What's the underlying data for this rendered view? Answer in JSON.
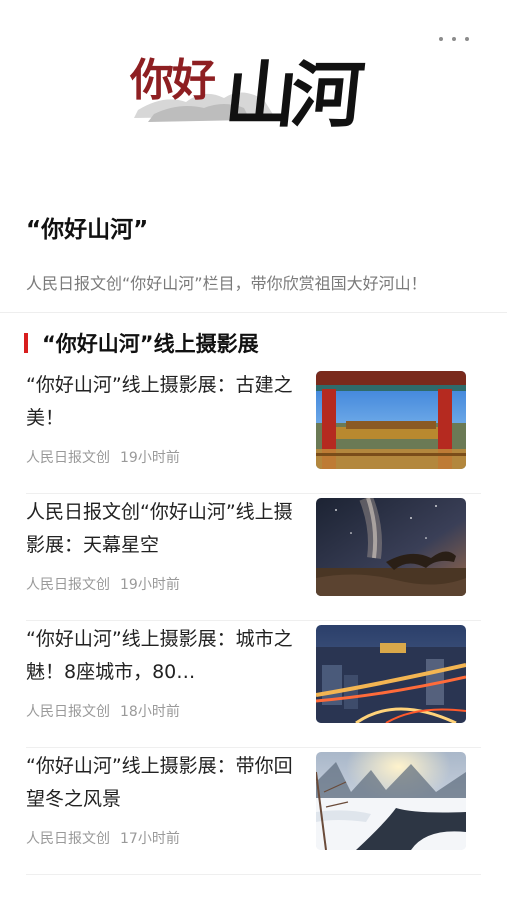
{
  "banner": {
    "logo_text_red": "你好",
    "logo_text_black": "山河",
    "more_icon": "more-horizontal-icon"
  },
  "intro": {
    "title": "“你好山河”",
    "description": "人民日报文创“你好山河”栏目，带你欣赏祖国大好河山！"
  },
  "section": {
    "title": "“你好山河”线上摄影展",
    "accent_color": "#d81e1e"
  },
  "articles": [
    {
      "title": "“你好山河”线上摄影展：古建之美！",
      "source": "人民日报文创",
      "time": "19小时前",
      "thumb": "palace-gate-photo"
    },
    {
      "title": "人民日报文创“你好山河”线上摄影展：天幕星空",
      "source": "人民日报文创",
      "time": "19小时前",
      "thumb": "milky-way-photo"
    },
    {
      "title": "“你好山河”线上摄影展：城市之魅！8座城市，80…",
      "source": "人民日报文创",
      "time": "18小时前",
      "thumb": "city-night-photo"
    },
    {
      "title": "“你好山河”线上摄影展：带你回望冬之风景",
      "source": "人民日报文创",
      "time": "17小时前",
      "thumb": "snow-river-photo"
    }
  ]
}
